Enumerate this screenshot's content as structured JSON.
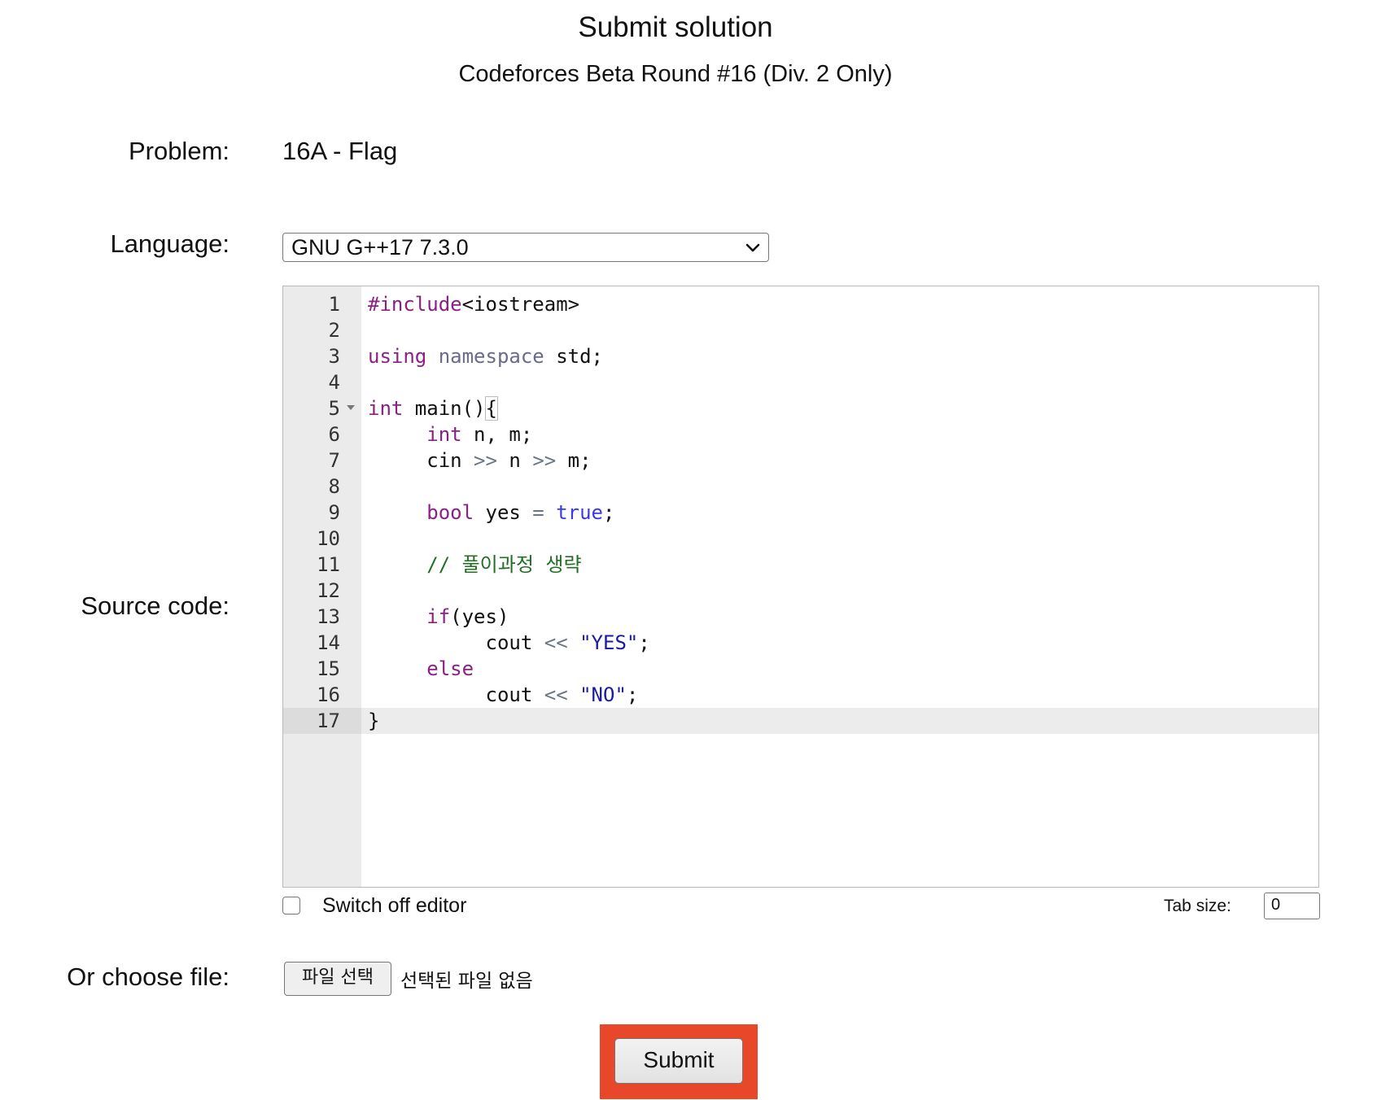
{
  "header": {
    "title": "Submit solution",
    "contest": "Codeforces Beta Round #16 (Div. 2 Only)"
  },
  "form": {
    "problem_label": "Problem:",
    "problem_value": "16A - Flag",
    "language_label": "Language:",
    "language_selected": "GNU G++17 7.3.0",
    "source_label": "Source code:",
    "switch_off_label": "Switch off editor",
    "switch_off_checked": false,
    "tab_size_label": "Tab size:",
    "tab_size_value": "0",
    "file_label": "Or choose file:",
    "file_button": "파일 선택",
    "file_status": "선택된 파일 없음",
    "submit_label": "Submit"
  },
  "editor": {
    "active_line": 17,
    "lines": [
      {
        "n": "1",
        "tokens": [
          {
            "t": "#include",
            "c": "kw"
          },
          {
            "t": "<iostream>",
            "c": ""
          }
        ]
      },
      {
        "n": "2",
        "tokens": []
      },
      {
        "n": "3",
        "tokens": [
          {
            "t": "using",
            "c": "kw"
          },
          {
            "t": " ",
            "c": ""
          },
          {
            "t": "namespace",
            "c": "kw2"
          },
          {
            "t": " std;",
            "c": ""
          }
        ]
      },
      {
        "n": "4",
        "tokens": []
      },
      {
        "n": "5",
        "fold": true,
        "tokens": [
          {
            "t": "int",
            "c": "kw"
          },
          {
            "t": " main()",
            "c": ""
          },
          {
            "t": "{",
            "c": "bracket"
          }
        ]
      },
      {
        "n": "6",
        "tokens": [
          {
            "t": "     ",
            "c": ""
          },
          {
            "t": "int",
            "c": "kw"
          },
          {
            "t": " n, m;",
            "c": ""
          }
        ]
      },
      {
        "n": "7",
        "tokens": [
          {
            "t": "     cin ",
            "c": ""
          },
          {
            "t": ">>",
            "c": "op"
          },
          {
            "t": " n ",
            "c": ""
          },
          {
            "t": ">>",
            "c": "op"
          },
          {
            "t": " m;",
            "c": ""
          }
        ]
      },
      {
        "n": "8",
        "tokens": []
      },
      {
        "n": "9",
        "tokens": [
          {
            "t": "     ",
            "c": ""
          },
          {
            "t": "bool",
            "c": "kw"
          },
          {
            "t": " yes ",
            "c": ""
          },
          {
            "t": "=",
            "c": "op"
          },
          {
            "t": " ",
            "c": ""
          },
          {
            "t": "true",
            "c": "lit"
          },
          {
            "t": ";",
            "c": ""
          }
        ]
      },
      {
        "n": "10",
        "tokens": []
      },
      {
        "n": "11",
        "tokens": [
          {
            "t": "     ",
            "c": ""
          },
          {
            "t": "// 풀이과정 생략",
            "c": "cmt"
          }
        ]
      },
      {
        "n": "12",
        "tokens": []
      },
      {
        "n": "13",
        "tokens": [
          {
            "t": "     ",
            "c": ""
          },
          {
            "t": "if",
            "c": "kw"
          },
          {
            "t": "(yes)",
            "c": ""
          }
        ]
      },
      {
        "n": "14",
        "tokens": [
          {
            "t": "          cout ",
            "c": ""
          },
          {
            "t": "<<",
            "c": "op"
          },
          {
            "t": " ",
            "c": ""
          },
          {
            "t": "\"YES\"",
            "c": "str"
          },
          {
            "t": ";",
            "c": ""
          }
        ]
      },
      {
        "n": "15",
        "tokens": [
          {
            "t": "     ",
            "c": ""
          },
          {
            "t": "else",
            "c": "kw"
          }
        ]
      },
      {
        "n": "16",
        "tokens": [
          {
            "t": "          cout ",
            "c": ""
          },
          {
            "t": "<<",
            "c": "op"
          },
          {
            "t": " ",
            "c": ""
          },
          {
            "t": "\"NO\"",
            "c": "str"
          },
          {
            "t": ";",
            "c": ""
          }
        ]
      },
      {
        "n": "17",
        "tokens": [
          {
            "t": "}",
            "c": ""
          }
        ]
      }
    ]
  },
  "colors": {
    "highlight_border": "#e9472a",
    "keyword": "#8b1f86",
    "string": "#1a1aa6",
    "comment": "#236e25"
  },
  "icons": {
    "language_dropdown": "chevron-down-icon",
    "fold_marker": "fold-arrow-icon"
  }
}
